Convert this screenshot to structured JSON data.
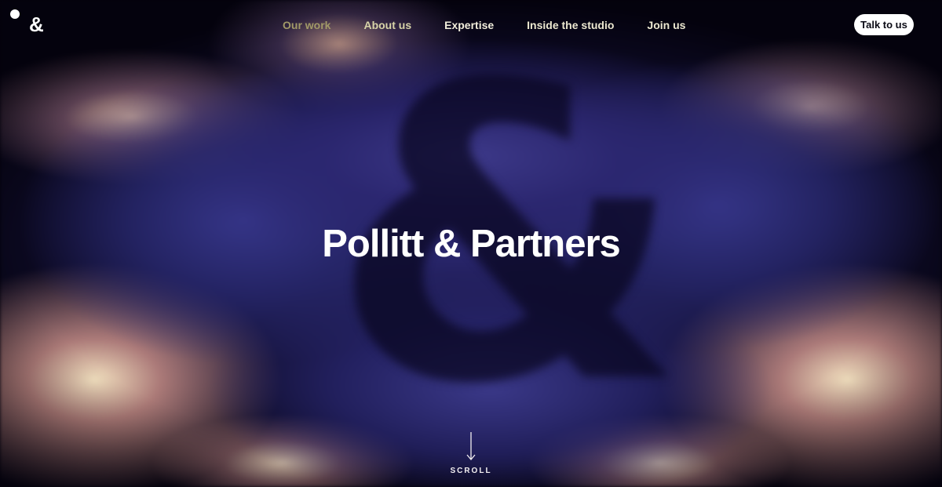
{
  "brand": {
    "logo_symbol": "&"
  },
  "nav": {
    "items": [
      {
        "label": "Our work"
      },
      {
        "label": "About us"
      },
      {
        "label": "Expertise"
      },
      {
        "label": "Inside the studio"
      },
      {
        "label": "Join us"
      }
    ]
  },
  "cta": {
    "label": "Talk to us"
  },
  "hero": {
    "title": "Pollitt & Partners",
    "background_icon": "ampersand-smoke-artwork"
  },
  "scroll": {
    "label": "SCROLL",
    "icon": "arrow-down-icon"
  },
  "colors": {
    "background": "#04020d",
    "smoke_blue": "#3a3a8c",
    "smoke_glow": "#ffecc8",
    "text": "#ffffff"
  }
}
